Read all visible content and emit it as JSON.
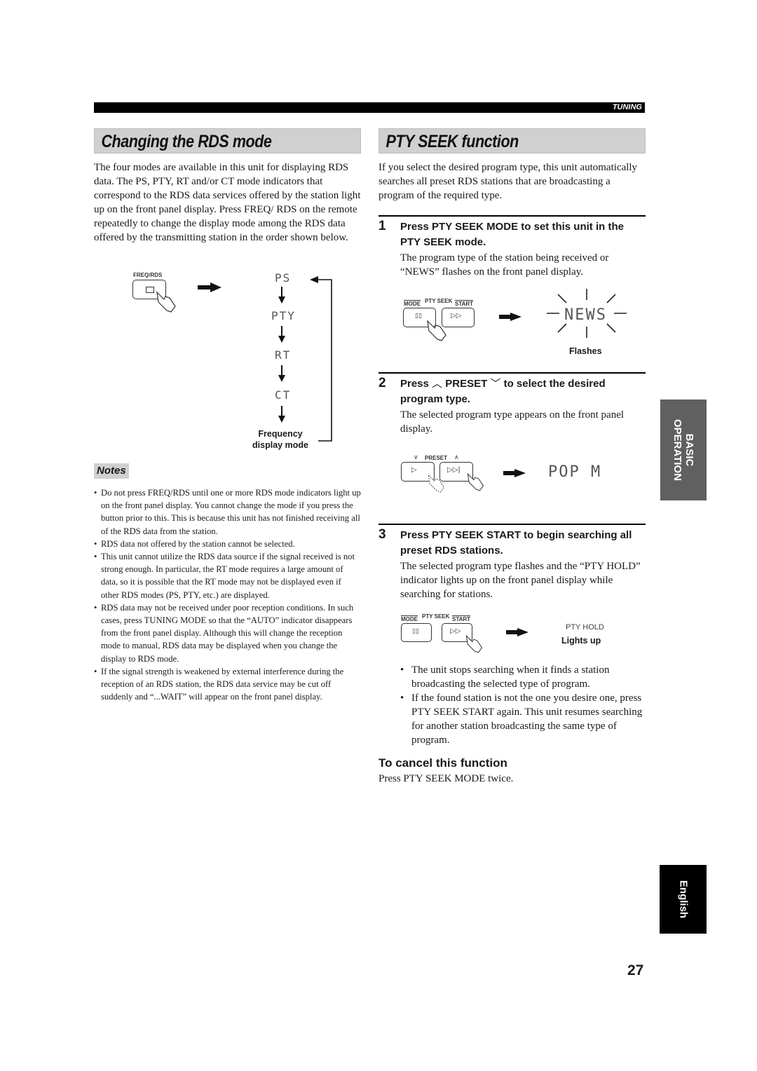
{
  "header": {
    "section_tab": "TUNING"
  },
  "left": {
    "title": "Changing the RDS mode",
    "intro": "The four modes are available in this unit for displaying RDS data. The PS, PTY, RT and/or CT mode indicators that correspond to the RDS data services offered by the station light up on the front panel display. Press FREQ/ RDS on the remote repeatedly to change the display mode among the RDS data offered by the transmitting station in the order shown below.",
    "diagram": {
      "button_label": "FREQ/RDS",
      "modes": [
        "PS",
        "PTY",
        "RT",
        "CT"
      ],
      "final_mode_line1": "Frequency",
      "final_mode_line2": "display mode"
    },
    "notes_label": "Notes",
    "notes": [
      "Do not press FREQ/RDS until one or more RDS mode indicators light up on the front panel display. You cannot change the mode if you press the button prior to this. This is because this unit has not finished receiving all of the RDS data from the station.",
      "RDS data not offered by the station cannot be selected.",
      "This unit cannot utilize the RDS data source if the signal received is not strong enough. In particular, the RT mode requires a large amount of data, so it is possible that the RT mode may not be displayed even if other RDS modes (PS, PTY, etc.) are displayed.",
      "RDS data may not be received under poor reception conditions. In such cases, press TUNING MODE so that the “AUTO” indicator disappears from the front panel display. Although this will change the reception mode to manual, RDS data may be displayed when you change the display to RDS mode.",
      "If the signal strength is weakened by external interference during the reception of an RDS station, the RDS data service may be cut off suddenly and “...WAIT” will appear on the front panel display."
    ]
  },
  "right": {
    "title": "PTY SEEK function",
    "intro": "If you select the desired program type, this unit automatically searches all preset RDS stations that are broadcasting a program of the required type.",
    "steps": [
      {
        "number": "1",
        "title": "Press PTY SEEK MODE to set this unit in the PTY SEEK mode.",
        "desc": "The program type of the station being received or “NEWS” flashes on the front panel display.",
        "fig": {
          "mode_label": "MODE",
          "group_label": "PTY SEEK",
          "start_label": "START",
          "display": "NEWS",
          "caption": "Flashes"
        }
      },
      {
        "number": "2",
        "title_pre": "Press ",
        "title_key": "PRESET",
        "title_post": " to select the desired program type.",
        "desc": "The selected program type appears on the front panel display.",
        "fig": {
          "preset_label": "PRESET",
          "display": "POP M"
        }
      },
      {
        "number": "3",
        "title": "Press PTY SEEK START to begin searching all preset RDS stations.",
        "desc": "The selected program type flashes and the “PTY HOLD” indicator lights up on the front panel display while searching for stations.",
        "fig": {
          "mode_label": "MODE",
          "group_label": "PTY SEEK",
          "start_label": "START",
          "display": "PTY HOLD",
          "caption": "Lights up"
        }
      }
    ],
    "bullets": [
      "The unit stops searching when it finds a station broadcasting the selected type of program.",
      "If the found station is not the one you desire one, press PTY SEEK START again. This unit resumes searching for another station broadcasting the same type of program."
    ],
    "cancel_title": "To cancel this function",
    "cancel_text": "Press PTY SEEK MODE twice."
  },
  "side_tabs": {
    "section_line1": "BASIC",
    "section_line2": "OPERATION",
    "language": "English"
  },
  "footer": {
    "page_number": "27"
  }
}
